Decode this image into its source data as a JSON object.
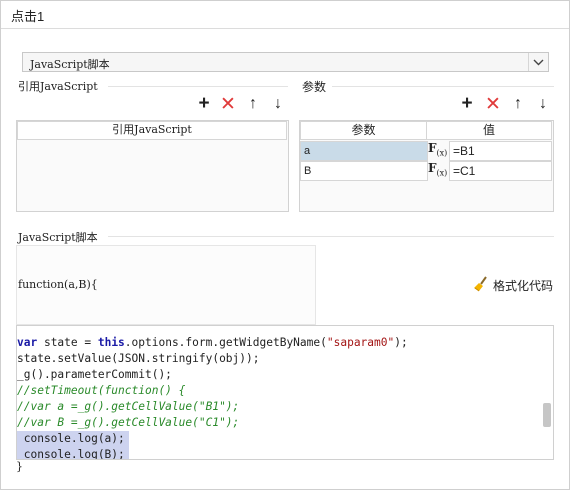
{
  "window": {
    "title": "点击1"
  },
  "script_type": {
    "selected": "JavaScript脚本"
  },
  "ref_section": {
    "label": "引用JavaScript",
    "column_header": "引用JavaScript"
  },
  "params_section": {
    "label": "参数",
    "col_param": "参数",
    "col_value": "值",
    "rows": [
      {
        "name": "a",
        "fx_main": "F",
        "fx_sub": "(x)",
        "value": "=B1"
      },
      {
        "name": "B",
        "fx_main": "F",
        "fx_sub": "(x)",
        "value": "=C1"
      }
    ]
  },
  "script_section": {
    "label": "JavaScript脚本",
    "signature": "function(a,B){",
    "format_button": "格式化代码",
    "closing": "}"
  },
  "toolbar": {
    "add": "+",
    "delete": "✕",
    "up": "↑",
    "down": "↓"
  },
  "code": {
    "l1_var": "var",
    "l1_a": " state = ",
    "l1_this": "this",
    "l1_b": ".options.form.getWidgetByName(",
    "l1_str": "\"saparam0\"",
    "l1_c": ");",
    "l2": "state.setValue(JSON.stringify(obj));",
    "l3": "_g().parameterCommit();",
    "l4": "//setTimeout(function() {",
    "l5": "//var a =_g().getCellValue(\"B1\");",
    "l6": "//var B =_g().getCellValue(\"C1\");",
    "l7": " console.log(a);",
    "l8": " console.log(B);"
  }
}
